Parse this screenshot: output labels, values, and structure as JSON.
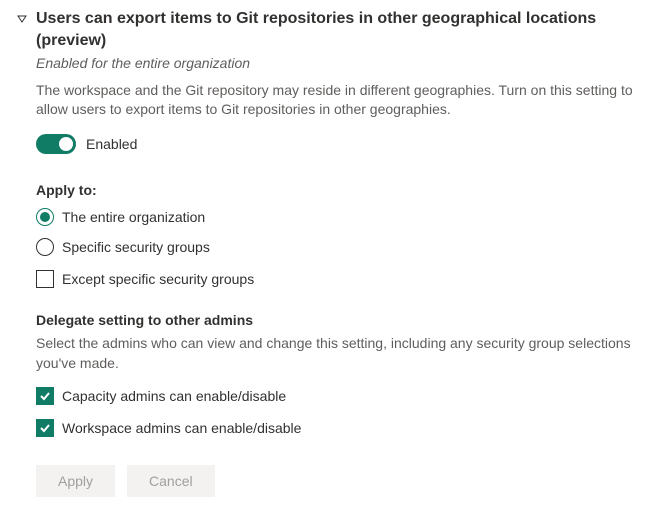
{
  "title": "Users can export items to Git repositories in other geographical locations (preview)",
  "scope": "Enabled for the entire organization",
  "description": "The workspace and the Git repository may reside in different geographies. Turn on this setting to allow users to export items to Git repositories in other geographies.",
  "toggle": {
    "label": "Enabled"
  },
  "applyTo": {
    "label": "Apply to:",
    "options": {
      "entireOrg": "The entire organization",
      "specificGroups": "Specific security groups"
    },
    "except": "Except specific security groups"
  },
  "delegate": {
    "heading": "Delegate setting to other admins",
    "description": "Select the admins who can view and change this setting, including any security group selections you've made.",
    "capacity": "Capacity admins can enable/disable",
    "workspace": "Workspace admins can enable/disable"
  },
  "buttons": {
    "apply": "Apply",
    "cancel": "Cancel"
  }
}
